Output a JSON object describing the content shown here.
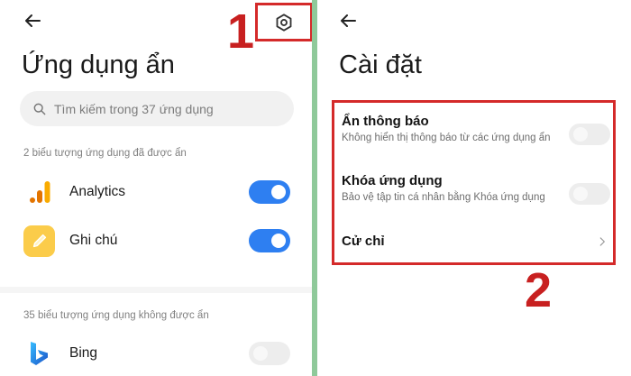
{
  "left": {
    "title": "Ứng dụng ẩn",
    "search_placeholder": "Tìm kiếm trong 37 ứng dụng",
    "hidden_section_label": "2 biểu tượng ứng dụng đã được ẩn",
    "hidden_apps": [
      {
        "name": "Analytics",
        "enabled": true
      },
      {
        "name": "Ghi chú",
        "enabled": true
      }
    ],
    "shown_section_label": "35 biểu tượng ứng dụng không được ẩn",
    "shown_apps": [
      {
        "name": "Bing",
        "enabled": false
      }
    ]
  },
  "right": {
    "title": "Cài đặt",
    "settings": [
      {
        "title": "Ẩn thông báo",
        "desc": "Không hiển thị thông báo từ các ứng dụng ẩn",
        "enabled": false
      },
      {
        "title": "Khóa ứng dụng",
        "desc": "Bảo vệ tập tin cá nhân bằng Khóa ứng dụng",
        "enabled": false
      },
      {
        "title": "Cử chỉ"
      }
    ]
  },
  "annotations": {
    "step1": "1",
    "step2": "2"
  },
  "icons": {
    "back": "arrow-left-icon",
    "settings": "gear-icon",
    "search": "search-icon",
    "chevron": "chevron-right-icon"
  },
  "colors": {
    "toggle_on": "#2e7ff1",
    "highlight": "#d42a2a",
    "divider": "#8fc99a"
  }
}
